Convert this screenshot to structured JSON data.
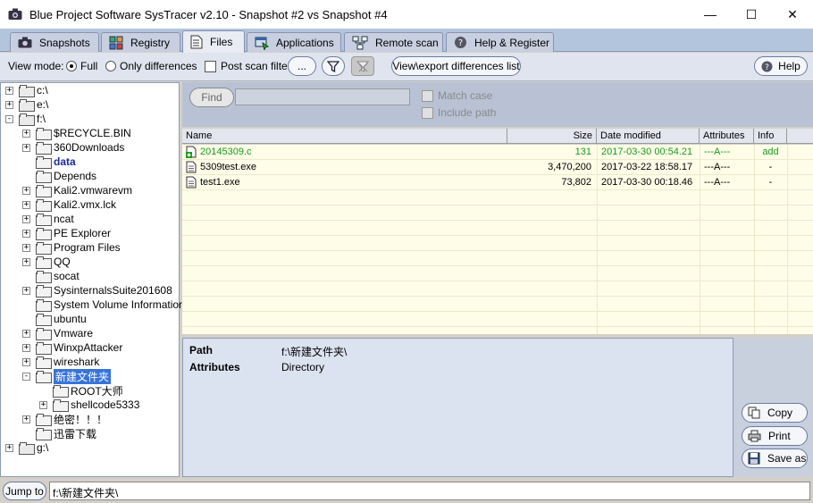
{
  "window": {
    "title": "Blue Project Software SysTracer v2.10 - Snapshot #2 vs Snapshot #4",
    "minimize": "—",
    "maximize": "☐",
    "close": "✕"
  },
  "tabs": [
    {
      "label": "Snapshots",
      "icon": "camera-icon"
    },
    {
      "label": "Registry",
      "icon": "registry-icon"
    },
    {
      "label": "Files",
      "icon": "files-icon"
    },
    {
      "label": "Applications",
      "icon": "applications-icon"
    },
    {
      "label": "Remote scan",
      "icon": "network-icon"
    },
    {
      "label": "Help & Register",
      "icon": "help-icon"
    }
  ],
  "active_tab": "Files",
  "toolbar": {
    "view_mode_label": "View mode:",
    "full_label": "Full",
    "only_diff_label": "Only differences",
    "post_scan_label": "Post scan filter",
    "more_label": "...",
    "export_label": "View\\export differences list",
    "help_label": "Help"
  },
  "tree": [
    {
      "label": "c:\\",
      "level": 0,
      "expander": "+",
      "type": "drive"
    },
    {
      "label": "e:\\",
      "level": 0,
      "expander": "+",
      "type": "drive"
    },
    {
      "label": "f:\\",
      "level": 0,
      "expander": "-",
      "type": "drive"
    },
    {
      "label": "$RECYCLE.BIN",
      "level": 1,
      "expander": "+",
      "type": "folder"
    },
    {
      "label": "360Downloads",
      "level": 1,
      "expander": "+",
      "type": "folder"
    },
    {
      "label": "data",
      "level": 1,
      "expander": "",
      "type": "folder",
      "style": "bold"
    },
    {
      "label": "Depends",
      "level": 1,
      "expander": "",
      "type": "folder"
    },
    {
      "label": "Kali2.vmwarevm",
      "level": 1,
      "expander": "+",
      "type": "folder"
    },
    {
      "label": "Kali2.vmx.lck",
      "level": 1,
      "expander": "+",
      "type": "folder"
    },
    {
      "label": "ncat",
      "level": 1,
      "expander": "+",
      "type": "folder"
    },
    {
      "label": "PE Explorer",
      "level": 1,
      "expander": "+",
      "type": "folder"
    },
    {
      "label": "Program Files",
      "level": 1,
      "expander": "+",
      "type": "folder"
    },
    {
      "label": "QQ",
      "level": 1,
      "expander": "+",
      "type": "folder"
    },
    {
      "label": "socat",
      "level": 1,
      "expander": "",
      "type": "folder"
    },
    {
      "label": "SysinternalsSuite201608",
      "level": 1,
      "expander": "+",
      "type": "folder"
    },
    {
      "label": "System Volume Information",
      "level": 1,
      "expander": "",
      "type": "folder"
    },
    {
      "label": "ubuntu",
      "level": 1,
      "expander": "",
      "type": "folder"
    },
    {
      "label": "Vmware",
      "level": 1,
      "expander": "+",
      "type": "folder"
    },
    {
      "label": "WinxpAttacker",
      "level": 1,
      "expander": "+",
      "type": "folder"
    },
    {
      "label": "wireshark",
      "level": 1,
      "expander": "+",
      "type": "folder"
    },
    {
      "label": "新建文件夹",
      "level": 1,
      "expander": "-",
      "type": "folder",
      "style": "selected"
    },
    {
      "label": "ROOT大师",
      "level": 2,
      "expander": "",
      "type": "folder"
    },
    {
      "label": "shellcode5333",
      "level": 2,
      "expander": "+",
      "type": "folder"
    },
    {
      "label": "绝密！！！",
      "level": 1,
      "expander": "+",
      "type": "folder"
    },
    {
      "label": "迅雷下载",
      "level": 1,
      "expander": "",
      "type": "folder"
    },
    {
      "label": "g:\\",
      "level": 0,
      "expander": "+",
      "type": "drive"
    }
  ],
  "find": {
    "button_label": "Find",
    "input_value": "",
    "match_case_label": "Match case",
    "include_path_label": "Include path"
  },
  "columns": [
    "Name",
    "Size",
    "Date modified",
    "Attributes",
    "Info"
  ],
  "files": [
    {
      "name": "20145309.c",
      "size": "131",
      "date": "2017-03-30 00:54.21",
      "attributes": "---A---",
      "info": "add",
      "color": "#1a9a1a",
      "icon": "file-added-icon"
    },
    {
      "name": "5309test.exe",
      "size": "3,470,200",
      "date": "2017-03-22 18:58.17",
      "attributes": "---A---",
      "info": "-",
      "color": "#000000",
      "icon": "file-icon"
    },
    {
      "name": "test1.exe",
      "size": "73,802",
      "date": "2017-03-30 00:18.46",
      "attributes": "---A---",
      "info": "-",
      "color": "#000000",
      "icon": "file-icon"
    }
  ],
  "details": {
    "path_label": "Path",
    "path_value": "f:\\新建文件夹\\",
    "attributes_label": "Attributes",
    "attributes_value": "Directory"
  },
  "actions": {
    "copy_label": "Copy",
    "print_label": "Print",
    "save_label": "Save as"
  },
  "status": {
    "jump_label": "Jump to",
    "path_value": "f:\\新建文件夹\\"
  }
}
